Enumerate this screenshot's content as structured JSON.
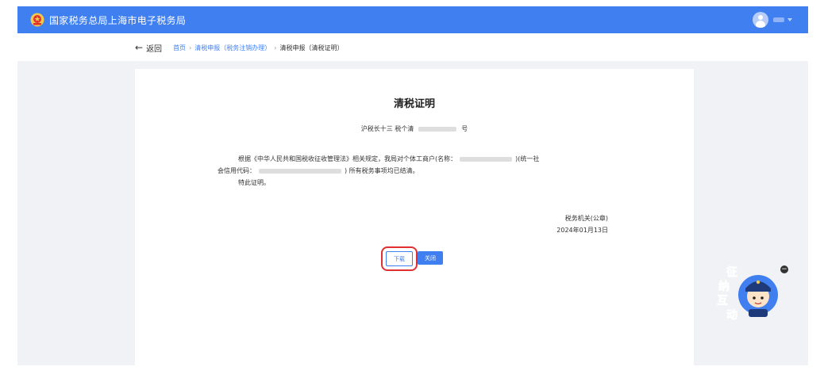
{
  "header": {
    "site_title": "国家税务总局上海市电子税务局",
    "logo_icon": "tax-emblem-icon",
    "user_icon": "user-avatar-icon"
  },
  "breadcrumb": {
    "back_label": "返回",
    "items": [
      "首页",
      "清税申报（税务注销办理）",
      "清税申报（清税证明）"
    ]
  },
  "document": {
    "title": "清税证明",
    "number_prefix": "沪税长十三 税个清",
    "number_suffix": "号",
    "line1_a": "根据《中华人民共和国税收征收管理法》相关规定，我局对个体工商户(名称：",
    "line1_b": ")(统一社",
    "line2_a": "会信用代码：",
    "line2_b": ") 所有税务事项均已结清。",
    "line3": "特此证明。",
    "signer": "税务机关(公章)",
    "date": "2024年01月13日"
  },
  "actions": {
    "download_label": "下载",
    "close_label": "关闭"
  },
  "widget": {
    "chars": [
      "征",
      "纳",
      "互",
      "动"
    ],
    "close_glyph": "−"
  },
  "colors": {
    "brand_blue": "#3f7ff0",
    "highlight_red": "#e23030",
    "stage_gray": "#f1f2f5"
  }
}
